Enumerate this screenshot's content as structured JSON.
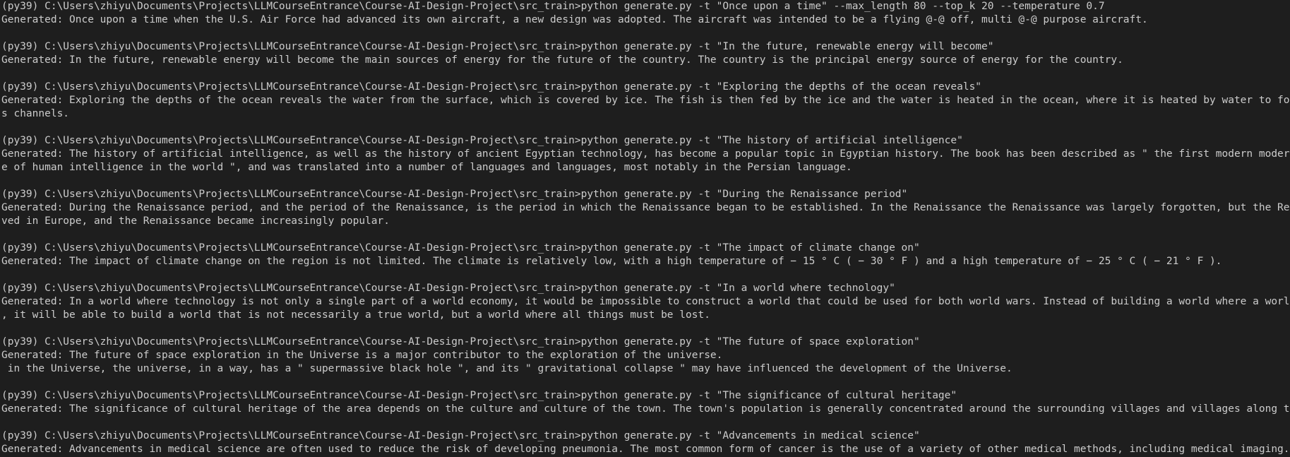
{
  "terminal": {
    "lines": [
      "(py39) C:\\Users\\zhiyu\\Documents\\Projects\\LLMCourseEntrance\\Course-AI-Design-Project\\src_train>python generate.py -t \"Once upon a time\" --max_length 80 --top_k 20 --temperature 0.7",
      "Generated: Once upon a time when the U.S. Air Force had advanced its own aircraft, a new design was adopted. The aircraft was intended to be a flying @-@ off, multi @-@ purpose aircraft.",
      "",
      "(py39) C:\\Users\\zhiyu\\Documents\\Projects\\LLMCourseEntrance\\Course-AI-Design-Project\\src_train>python generate.py -t \"In the future, renewable energy will become\"",
      "Generated: In the future, renewable energy will become the main sources of energy for the future of the country. The country is the principal energy source of energy for the country.",
      "",
      "(py39) C:\\Users\\zhiyu\\Documents\\Projects\\LLMCourseEntrance\\Course-AI-Design-Project\\src_train>python generate.py -t \"Exploring the depths of the ocean reveals\"",
      "Generated: Exploring the depths of the ocean reveals the water from the surface, which is covered by ice. The fish is then fed by the ice and the water is heated in the ocean, where it is heated by water to form the lake and it",
      "s channels.",
      "",
      "(py39) C:\\Users\\zhiyu\\Documents\\Projects\\LLMCourseEntrance\\Course-AI-Design-Project\\src_train>python generate.py -t \"The history of artificial intelligence\"",
      "Generated: The history of artificial intelligence, as well as the history of ancient Egyptian technology, has become a popular topic in Egyptian history. The book has been described as \" the first modern modern @-@ day knowledg",
      "e of human intelligence in the world \", and was translated into a number of languages and languages, most notably in the Persian language.",
      "",
      "(py39) C:\\Users\\zhiyu\\Documents\\Projects\\LLMCourseEntrance\\Course-AI-Design-Project\\src_train>python generate.py -t \"During the Renaissance period\"",
      "Generated: During the Renaissance period, and the period of the Renaissance, is the period in which the Renaissance began to be established. In the Renaissance the Renaissance was largely forgotten, but the Renaissance was revi",
      "ved in Europe, and the Renaissance became increasingly popular.",
      "",
      "(py39) C:\\Users\\zhiyu\\Documents\\Projects\\LLMCourseEntrance\\Course-AI-Design-Project\\src_train>python generate.py -t \"The impact of climate change on\"",
      "Generated: The impact of climate change on the region is not limited. The climate is relatively low, with a high temperature of − 15 ° C ( − 30 ° F ) and a high temperature of − 25 ° C ( − 21 ° F ).",
      "",
      "(py39) C:\\Users\\zhiyu\\Documents\\Projects\\LLMCourseEntrance\\Course-AI-Design-Project\\src_train>python generate.py -t \"In a world where technology\"",
      "Generated: In a world where technology is not only a single part of a world economy, it would be impossible to construct a world that could be used for both world wars. Instead of building a world where a world is at its center",
      ", it will be able to build a world that is not necessarily a true world, but a world where all things must be lost.",
      "",
      "(py39) C:\\Users\\zhiyu\\Documents\\Projects\\LLMCourseEntrance\\Course-AI-Design-Project\\src_train>python generate.py -t \"The future of space exploration\"",
      "Generated: The future of space exploration in the Universe is a major contributor to the exploration of the universe.",
      " in the Universe, the universe, in a way, has a \" supermassive black hole \", and its \" gravitational collapse \" may have influenced the development of the Universe.",
      "",
      "(py39) C:\\Users\\zhiyu\\Documents\\Projects\\LLMCourseEntrance\\Course-AI-Design-Project\\src_train>python generate.py -t \"The significance of cultural heritage\"",
      "Generated: The significance of cultural heritage of the area depends on the culture and culture of the town. The town's population is generally concentrated around the surrounding villages and villages along the roads.",
      "",
      "(py39) C:\\Users\\zhiyu\\Documents\\Projects\\LLMCourseEntrance\\Course-AI-Design-Project\\src_train>python generate.py -t \"Advancements in medical science\"",
      "Generated: Advancements in medical science are often used to reduce the risk of developing pneumonia. The most common form of cancer is the use of a variety of other medical methods, including medical imaging."
    ]
  },
  "colors": {
    "background": "#1e1e1e",
    "text": "#cccccc"
  }
}
